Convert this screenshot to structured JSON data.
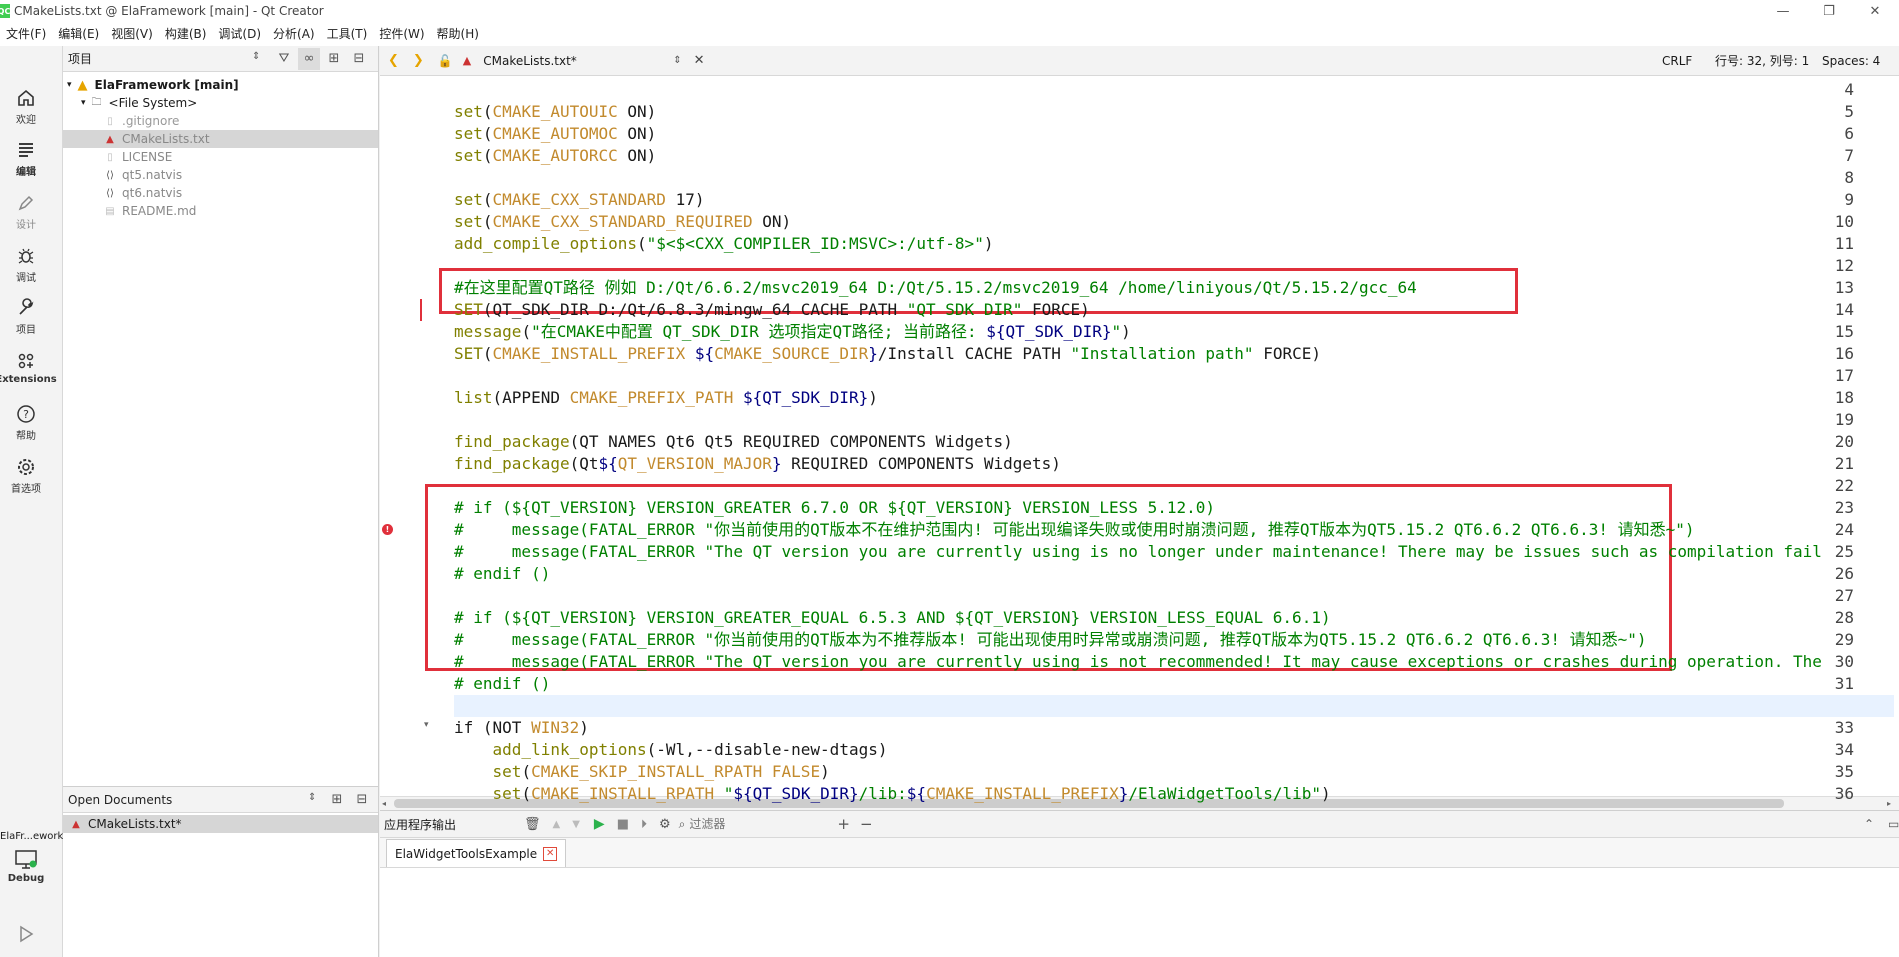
{
  "window": {
    "title": "CMakeLists.txt @ ElaFramework [main] - Qt Creator",
    "app_icon": "QC"
  },
  "menubar": {
    "items": [
      "文件(F)",
      "编辑(E)",
      "视图(V)",
      "构建(B)",
      "调试(D)",
      "分析(A)",
      "工具(T)",
      "控件(W)",
      "帮助(H)"
    ]
  },
  "activitybar": {
    "items": [
      {
        "label": "欢迎",
        "icon": "home-icon"
      },
      {
        "label": "编辑",
        "icon": "edit-lines-icon"
      },
      {
        "label": "设计",
        "icon": "pen-icon"
      },
      {
        "label": "调试",
        "icon": "bug-icon"
      },
      {
        "label": "项目",
        "icon": "wrench-icon"
      },
      {
        "label": "Extensions",
        "icon": "extensions-icon"
      },
      {
        "label": "帮助",
        "icon": "help-icon"
      },
      {
        "label": "首选项",
        "icon": "gear-icon"
      }
    ],
    "kit_name": "ElaFr...ework",
    "kit_mode": "Debug"
  },
  "project_panel": {
    "combo": "项目",
    "tree": {
      "root": "ElaFramework [main]",
      "filesystem": "<File System>",
      "files": [
        ".gitignore",
        "CMakeLists.txt",
        "LICENSE",
        "qt5.natvis",
        "qt6.natvis",
        "README.md"
      ]
    }
  },
  "open_documents": {
    "title": "Open Documents",
    "files": [
      "CMakeLists.txt*"
    ]
  },
  "editor": {
    "tab_file": "CMakeLists.txt*",
    "line_ending": "CRLF",
    "position": "行号: 32, 列号: 1",
    "spaces": "Spaces: 4",
    "lines": [
      {
        "n": "4",
        "text": ""
      },
      {
        "n": "5",
        "text": "set(CMAKE_AUTOUIC ON)"
      },
      {
        "n": "6",
        "text": "set(CMAKE_AUTOMOC ON)"
      },
      {
        "n": "7",
        "text": "set(CMAKE_AUTORCC ON)"
      },
      {
        "n": "8",
        "text": ""
      },
      {
        "n": "9",
        "text": "set(CMAKE_CXX_STANDARD 17)"
      },
      {
        "n": "10",
        "text": "set(CMAKE_CXX_STANDARD_REQUIRED ON)"
      },
      {
        "n": "11",
        "text": "add_compile_options(\"$<$<CXX_COMPILER_ID:MSVC>:/utf-8>\")"
      },
      {
        "n": "12",
        "text": ""
      },
      {
        "n": "13",
        "text": "#在这里配置QT路径 例如 D:/Qt/6.6.2/msvc2019_64 D:/Qt/5.15.2/msvc2019_64 /home/liniyous/Qt/5.15.2/gcc_64"
      },
      {
        "n": "14",
        "text": "SET(QT_SDK_DIR D:/Qt/6.8.3/mingw_64 CACHE PATH \"QT SDK DIR\" FORCE)"
      },
      {
        "n": "15",
        "text": "message(\"在CMAKE中配置 QT_SDK_DIR 选项指定QT路径; 当前路径: ${QT_SDK_DIR}\")"
      },
      {
        "n": "16",
        "text": "SET(CMAKE_INSTALL_PREFIX ${CMAKE_SOURCE_DIR}/Install CACHE PATH \"Installation path\" FORCE)"
      },
      {
        "n": "17",
        "text": ""
      },
      {
        "n": "18",
        "text": "list(APPEND CMAKE_PREFIX_PATH ${QT_SDK_DIR})"
      },
      {
        "n": "19",
        "text": ""
      },
      {
        "n": "20",
        "text": "find_package(QT NAMES Qt6 Qt5 REQUIRED COMPONENTS Widgets)"
      },
      {
        "n": "21",
        "text": "find_package(Qt${QT_VERSION_MAJOR} REQUIRED COMPONENTS Widgets)"
      },
      {
        "n": "22",
        "text": ""
      },
      {
        "n": "23",
        "text": "# if (${QT_VERSION} VERSION_GREATER 6.7.0 OR ${QT_VERSION} VERSION_LESS 5.12.0)"
      },
      {
        "n": "24",
        "text": "#     message(FATAL_ERROR \"你当前使用的QT版本不在维护范围内! 可能出现编译失败或使用时崩溃问题, 推荐QT版本为QT5.15.2 QT6.6.2 QT6.6.3! 请知悉~\")"
      },
      {
        "n": "25",
        "text": "#     message(FATAL_ERROR \"The QT version you are currently using is no longer under maintenance! There may be issues such as compilation fail"
      },
      {
        "n": "26",
        "text": "# endif ()"
      },
      {
        "n": "27",
        "text": ""
      },
      {
        "n": "28",
        "text": "# if (${QT_VERSION} VERSION_GREATER_EQUAL 6.5.3 AND ${QT_VERSION} VERSION_LESS_EQUAL 6.6.1)"
      },
      {
        "n": "29",
        "text": "#     message(FATAL_ERROR \"你当前使用的QT版本为不推荐版本! 可能出现使用时异常或崩溃问题, 推荐QT版本为QT5.15.2 QT6.6.2 QT6.6.3! 请知悉~\")"
      },
      {
        "n": "30",
        "text": "#     message(FATAL_ERROR \"The QT version you are currently using is not recommended! It may cause exceptions or crashes during operation. The"
      },
      {
        "n": "31",
        "text": "# endif ()"
      },
      {
        "n": "32",
        "text": ""
      },
      {
        "n": "33",
        "text": "if (NOT WIN32)"
      },
      {
        "n": "34",
        "text": "    add_link_options(-Wl,--disable-new-dtags)"
      },
      {
        "n": "35",
        "text": "    set(CMAKE_SKIP_INSTALL_RPATH FALSE)"
      },
      {
        "n": "36",
        "text": "    set(CMAKE_INSTALL_RPATH \"${QT_SDK_DIR}/lib:${CMAKE_INSTALL_PREFIX}/ElaWidgetTools/lib\")"
      }
    ]
  },
  "bottom_panel": {
    "title": "应用程序输出",
    "filter_placeholder": "过滤器",
    "tab": "ElaWidgetToolsExample",
    "tab_close": "✕"
  },
  "colors": {
    "highlight_box": "#e0303b",
    "keyword": "#808000",
    "variable": "#c28a2d",
    "comment": "#008000"
  }
}
